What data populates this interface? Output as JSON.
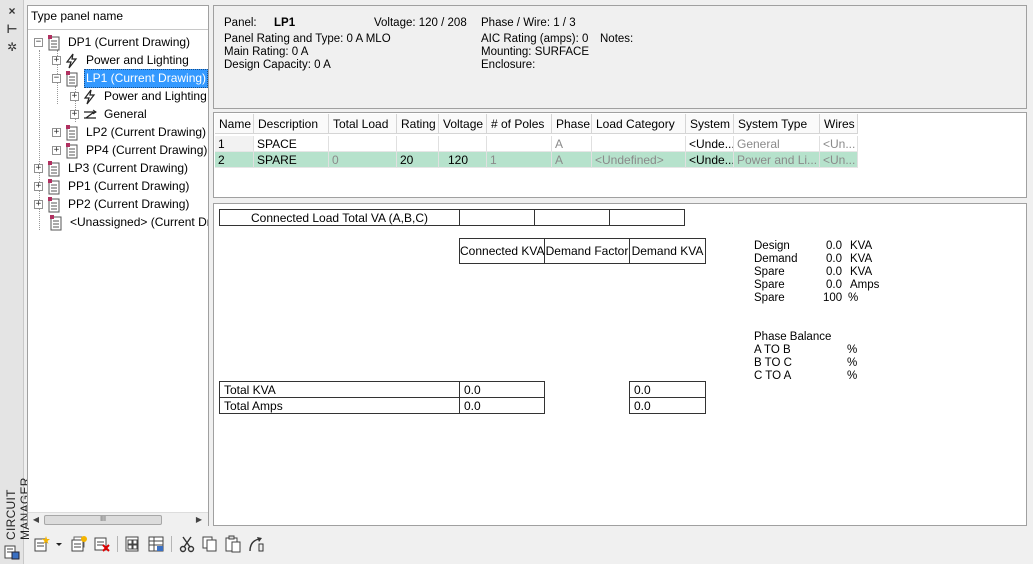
{
  "window": {
    "vertical_title": "CIRCUIT MANAGER"
  },
  "strip": {
    "close_glyph": "×",
    "pin_glyph": "⊢",
    "settings_glyph": "✲"
  },
  "tree": {
    "search_placeholder": "Type panel name",
    "nodes": [
      {
        "label": "DP1 (Current Drawing)",
        "icon": "panel-icon",
        "expander": "−"
      },
      {
        "label": "Power and Lighting",
        "icon": "lightning-icon",
        "expander": "+"
      },
      {
        "label": "LP1 (Current Drawing)",
        "icon": "panel-icon",
        "expander": "−",
        "selected": true
      },
      {
        "label": "Power and Lighting",
        "icon": "lightning-icon",
        "expander": "+"
      },
      {
        "label": "General",
        "icon": "general-icon",
        "expander": "+"
      },
      {
        "label": "LP2 (Current Drawing)",
        "icon": "panel-icon",
        "expander": "+"
      },
      {
        "label": "PP4 (Current Drawing)",
        "icon": "panel-icon",
        "expander": "+"
      },
      {
        "label": "LP3 (Current Drawing)",
        "icon": "panel-icon",
        "expander": "+"
      },
      {
        "label": "PP1 (Current Drawing)",
        "icon": "panel-icon",
        "expander": "+"
      },
      {
        "label": "PP2 (Current Drawing)",
        "icon": "panel-icon",
        "expander": "+"
      },
      {
        "label": "<Unassigned> (Current Dr",
        "icon": "panel-icon",
        "expander": ""
      }
    ],
    "scroll_thumb_glyph": "III"
  },
  "panel_info": {
    "panel_label": "Panel:",
    "panel_value": "LP1",
    "voltage": "Voltage: 120 / 208",
    "phase_wire": "Phase / Wire:  1 /  3",
    "rating_type": "Panel Rating and Type: 0 A MLO",
    "main_rating": "Main Rating: 0 A",
    "design_capacity": "Design Capacity: 0 A",
    "aic_rating": "AIC Rating (amps):  0",
    "mounting": "Mounting: SURFACE",
    "enclosure": "Enclosure:",
    "notes": "Notes:"
  },
  "circuits": {
    "columns": [
      "Name",
      "Description",
      "Total Load",
      "Rating",
      "Voltage",
      "# of Poles",
      "Phase",
      "Load Category",
      "System",
      "System Type",
      "Wires"
    ],
    "rows": [
      [
        "1",
        "SPACE",
        "",
        "",
        "",
        "",
        "A",
        "",
        "<Unde...",
        "General",
        "<Un..."
      ],
      [
        "2",
        "SPARE",
        "0",
        "20",
        "120",
        "1",
        "A",
        "<Undefined>",
        "<Unde...",
        "Power and Li...",
        "<Un..."
      ]
    ]
  },
  "summary": {
    "connected_load_label": "Connected Load Total VA (A,B,C)",
    "col_connected_kva": "Connected KVA",
    "col_demand_factor": "Demand Factor",
    "col_demand_kva": "Demand KVA",
    "total_kva_label": "Total KVA",
    "total_amps_label": "Total Amps",
    "total_kva_connected": "0.0",
    "total_kva_demand": "0.0",
    "total_amps_connected": "0.0",
    "total_amps_demand": "0.0"
  },
  "stats": [
    {
      "label": "Design",
      "value": "0.0",
      "unit": "KVA"
    },
    {
      "label": "Demand",
      "value": "0.0",
      "unit": "KVA"
    },
    {
      "label": "Spare",
      "value": "0.0",
      "unit": "KVA"
    },
    {
      "label": "Spare",
      "value": "0.0",
      "unit": "Amps"
    },
    {
      "label": "Spare",
      "value": "100",
      "unit": "%"
    }
  ],
  "phase_balance": {
    "title": "Phase Balance",
    "items": [
      {
        "label": "A TO B",
        "unit": "%"
      },
      {
        "label": "B TO C",
        "unit": "%"
      },
      {
        "label": "C TO A",
        "unit": "%"
      }
    ]
  },
  "toolbar": {
    "buttons": [
      "new-circuit-icon",
      "dropdown-arrow-icon",
      "new-circuits-icon",
      "delete-circuit-icon",
      "edit-panel-icon",
      "panel-schedule-icon",
      "cut-icon",
      "copy-icon",
      "paste-icon",
      "wire-icon"
    ]
  },
  "colors": {
    "selection": "#3399ff",
    "row_highlight": "#b6e2cc",
    "panel_icon": "#b03060"
  }
}
